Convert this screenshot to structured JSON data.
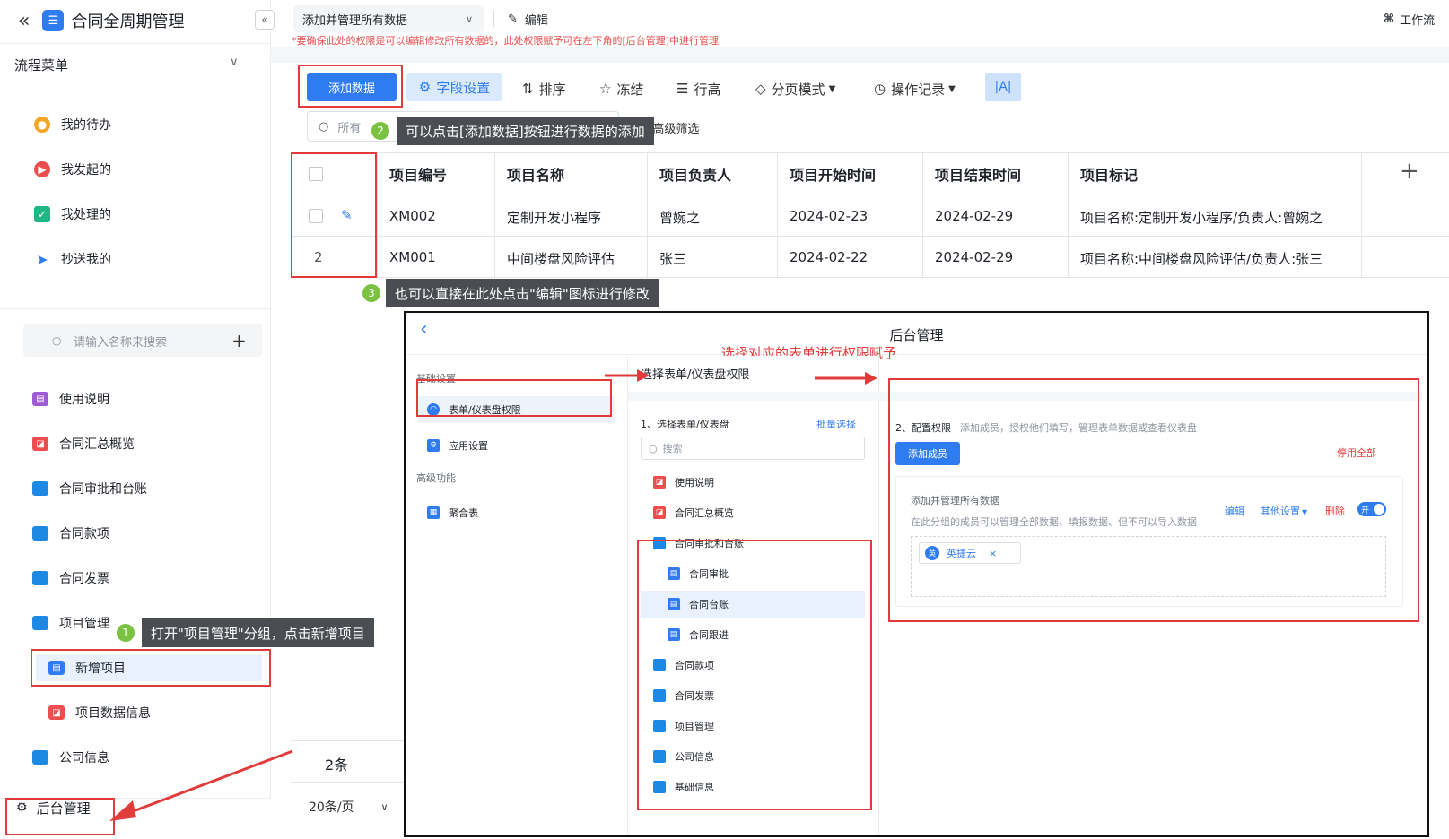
{
  "app": {
    "title": "合同全周期管理",
    "logo_glyph": "☰",
    "collapse_glyph": "«",
    "collapse_back": "«"
  },
  "header": {
    "tab_label": "添加并管理所有数据",
    "edit_label": "编辑",
    "workflow_label": "工作流",
    "warning": "*要确保此处的权限是可以编辑修改所有数据的，此处权限赋予可在左下角的[后台管理]中进行管理"
  },
  "sidebar": {
    "flow_menu_title": "流程菜单",
    "flow_items": [
      {
        "label": "我的待办",
        "color": "#f5a623"
      },
      {
        "label": "我发起的",
        "color": "#ee4d4d"
      },
      {
        "label": "我处理的",
        "color": "#20b785"
      },
      {
        "label": "抄送我的",
        "color": "#2f7cf0"
      }
    ],
    "search_placeholder": "请输入名称来搜索",
    "nav_items": [
      {
        "label": "使用说明",
        "type": "doc-purple"
      },
      {
        "label": "合同汇总概览",
        "type": "dash-red"
      },
      {
        "label": "合同审批和台账",
        "type": "folder"
      },
      {
        "label": "合同款项",
        "type": "folder"
      },
      {
        "label": "合同发票",
        "type": "folder"
      },
      {
        "label": "项目管理",
        "type": "folder"
      },
      {
        "label": "新增项目",
        "type": "form"
      },
      {
        "label": "项目数据信息",
        "type": "dash-red"
      },
      {
        "label": "公司信息",
        "type": "folder"
      }
    ],
    "admin_label": "后台管理"
  },
  "toolbar": {
    "add_data": "添加数据",
    "field_settings": "字段设置",
    "sort": "排序",
    "freeze": "冻结",
    "row_height": "行高",
    "page_mode": "分页模式",
    "history": "操作记录",
    "font_btn": "|A|",
    "filter_placeholder": "所有",
    "advanced_filter": "高级筛选"
  },
  "table": {
    "columns": [
      "项目编号",
      "项目名称",
      "项目负责人",
      "项目开始时间",
      "项目结束时间",
      "项目标记"
    ],
    "rows": [
      {
        "index": "",
        "cells": [
          "XM002",
          "定制开发小程序",
          "曾婉之",
          "2024-02-23",
          "2024-02-29",
          "项目名称:定制开发小程序/负责人:曾婉之"
        ]
      },
      {
        "index": "2",
        "cells": [
          "XM001",
          "中间楼盘风险评估",
          "张三",
          "2024-02-22",
          "2024-02-29",
          "项目名称:中间楼盘风险评估/负责人:张三"
        ]
      }
    ],
    "total": "2条",
    "page_size": "20条/页"
  },
  "tips": {
    "step1": {
      "num": "1",
      "text": "打开\"项目管理\"分组，点击新增项目"
    },
    "step2": {
      "num": "2",
      "text": "可以点击[添加数据]按钮进行数据的添加"
    },
    "step3": {
      "num": "3",
      "text": "也可以直接在此处点击\"编辑\"图标进行修改"
    }
  },
  "admin_panel": {
    "title": "后台管理",
    "annotation": "选择对应的表单进行权限赋予",
    "section_basic": "基础设置",
    "menu_form_perm": "表单/仪表盘权限",
    "menu_app_settings": "应用设置",
    "section_advanced": "高级功能",
    "menu_aggregate": "聚合表",
    "middle_title": "选择表单/仪表盘权限",
    "step1_label": "1、选择表单/仪表盘",
    "batch_select": "批量选择",
    "search_placeholder": "搜索",
    "tree": [
      {
        "label": "使用说明",
        "type": "dash-red",
        "indent": 0
      },
      {
        "label": "合同汇总概览",
        "type": "dash-red",
        "indent": 0
      },
      {
        "label": "合同审批和台账",
        "type": "folder",
        "indent": 0
      },
      {
        "label": "合同审批",
        "type": "form",
        "indent": 1
      },
      {
        "label": "合同台账",
        "type": "form",
        "indent": 1,
        "selected": true
      },
      {
        "label": "合同跟进",
        "type": "form",
        "indent": 1
      },
      {
        "label": "合同款项",
        "type": "folder",
        "indent": 0
      },
      {
        "label": "合同发票",
        "type": "folder",
        "indent": 0
      },
      {
        "label": "项目管理",
        "type": "folder",
        "indent": 0
      },
      {
        "label": "公司信息",
        "type": "folder",
        "indent": 0
      },
      {
        "label": "基础信息",
        "type": "folder",
        "indent": 0
      }
    ],
    "step2_label": "2、配置权限",
    "step2_hint": "添加成员，授权他们填写，管理表单数据或查看仪表盘",
    "add_member": "添加成员",
    "disable_all": "停用全部",
    "group_title": "添加并管理所有数据",
    "group_desc": "在此分组的成员可以管理全部数据、填报数据、但不可以导入数据",
    "group_edit": "编辑",
    "group_more": "其他设置",
    "group_delete": "删除",
    "toggle_label": "开",
    "member_avatar": "英",
    "member_name": "英捷云"
  }
}
